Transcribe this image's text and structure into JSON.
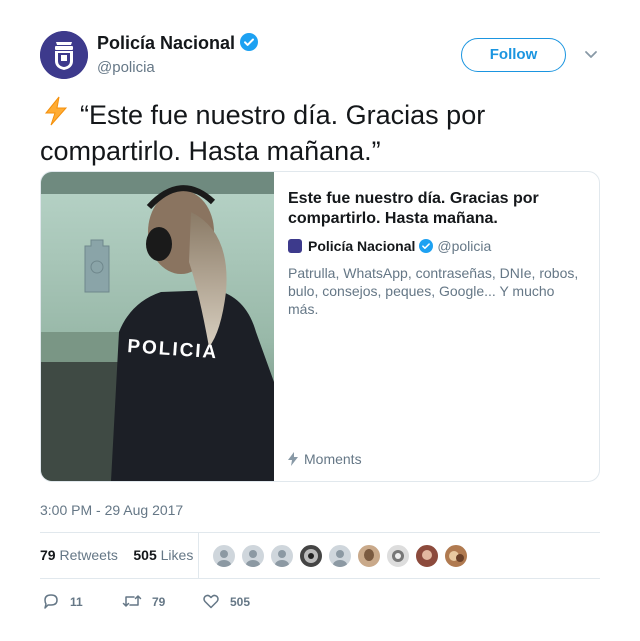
{
  "author": {
    "name": "Policía Nacional",
    "handle": "@policia",
    "verified": true,
    "avatar_icon": "police-badge-icon"
  },
  "follow_label": "Follow",
  "tweet": {
    "emoji": "⚡",
    "text": "“Este fue nuestro día. Gracias por compartirlo. Hasta mañana.”"
  },
  "card": {
    "image_text": "POLICIA",
    "title": "Este fue nuestro día. Gracias por compartirlo. Hasta mañana.",
    "author_name": "Policía Nacional",
    "author_handle": "@policia",
    "description": "Patrulla, WhatsApp, contraseñas, DNIe, robos, bulo, consejos, peques, Google... Y mucho más.",
    "footer": "Moments"
  },
  "timestamp": "3:00 PM - 29 Aug 2017",
  "stats": {
    "retweets_count": "79",
    "retweets_label": "Retweets",
    "likes_count": "505",
    "likes_label": "Likes"
  },
  "actions": {
    "replies": "11",
    "retweets": "79",
    "likes": "505"
  },
  "colors": {
    "accent": "#1b95e0",
    "text": "#14171a",
    "muted": "#657786",
    "border": "#e1e8ed",
    "brand": "#3d3a8c"
  }
}
